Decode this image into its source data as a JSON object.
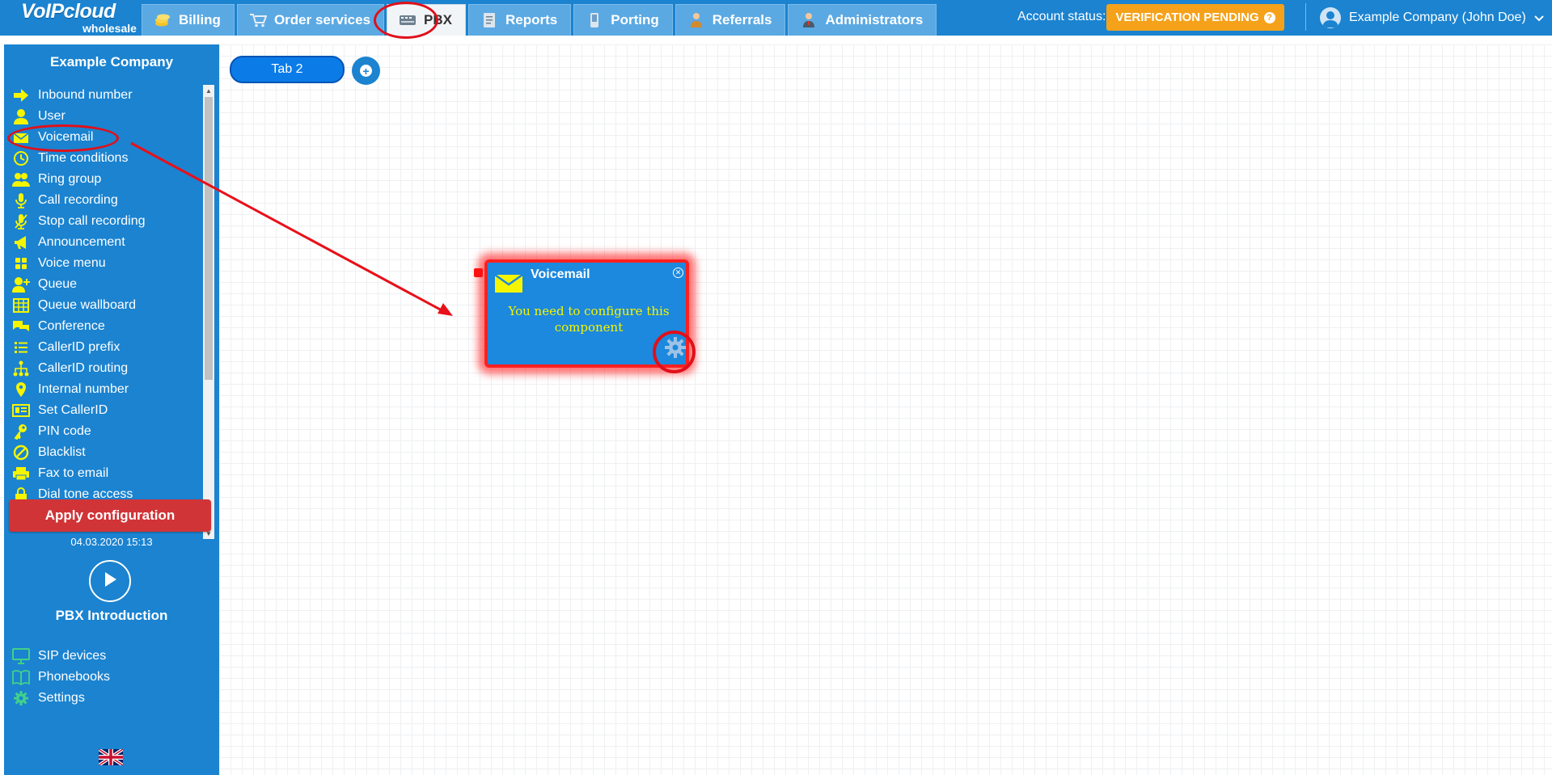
{
  "logo": {
    "brand": "VoIPcloud",
    "sub": "wholesale"
  },
  "nav": [
    {
      "label": "Billing",
      "icon": "coins-icon"
    },
    {
      "label": "Order services",
      "icon": "cart-icon"
    },
    {
      "label": "PBX",
      "icon": "pbx-icon",
      "active": true
    },
    {
      "label": "Reports",
      "icon": "report-icon"
    },
    {
      "label": "Porting",
      "icon": "phone-icon"
    },
    {
      "label": "Referrals",
      "icon": "referral-icon"
    },
    {
      "label": "Administrators",
      "icon": "admin-icon"
    }
  ],
  "account": {
    "status_label": "Account status:",
    "status": "VERIFICATION PENDING",
    "help": "?"
  },
  "user": {
    "name": "Example Company (John Doe)"
  },
  "sidebar": {
    "company": "Example Company",
    "items": [
      {
        "label": "Inbound number",
        "icon": "arrow-right-icon"
      },
      {
        "label": "User",
        "icon": "user-icon"
      },
      {
        "label": "Voicemail",
        "icon": "envelope-icon"
      },
      {
        "label": "Time conditions",
        "icon": "clock-icon"
      },
      {
        "label": "Ring group",
        "icon": "users-icon"
      },
      {
        "label": "Call recording",
        "icon": "microphone-icon"
      },
      {
        "label": "Stop call recording",
        "icon": "microphone-slash-icon"
      },
      {
        "label": "Announcement",
        "icon": "megaphone-icon"
      },
      {
        "label": "Voice menu",
        "icon": "grid-icon"
      },
      {
        "label": "Queue",
        "icon": "user-plus-icon"
      },
      {
        "label": "Queue wallboard",
        "icon": "table-icon"
      },
      {
        "label": "Conference",
        "icon": "chat-icon"
      },
      {
        "label": "CallerID prefix",
        "icon": "list-icon"
      },
      {
        "label": "CallerID routing",
        "icon": "sitemap-icon"
      },
      {
        "label": "Internal number",
        "icon": "map-pin-icon"
      },
      {
        "label": "Set CallerID",
        "icon": "id-card-icon"
      },
      {
        "label": "PIN code",
        "icon": "key-icon"
      },
      {
        "label": "Blacklist",
        "icon": "ban-icon"
      },
      {
        "label": "Fax to email",
        "icon": "printer-icon"
      },
      {
        "label": "Dial tone access",
        "icon": "lock-icon"
      }
    ],
    "apply_label": "Apply configuration",
    "apply_date": "04.03.2020 15:13",
    "intro_label": "PBX Introduction",
    "bottom_items": [
      {
        "label": "SIP devices",
        "icon": "monitor-icon"
      },
      {
        "label": "Phonebooks",
        "icon": "book-icon"
      },
      {
        "label": "Settings",
        "icon": "gear-icon"
      }
    ],
    "language": "uk-flag-icon"
  },
  "canvas": {
    "tab_label": "Tab 2",
    "component": {
      "title": "Voicemail",
      "message": "You need to configure this component"
    }
  },
  "colors": {
    "primary": "#1b83d0",
    "accent_yellow": "#f5f500",
    "warning": "#f5a21a",
    "danger": "#d13437",
    "highlight": "#e0101a"
  }
}
